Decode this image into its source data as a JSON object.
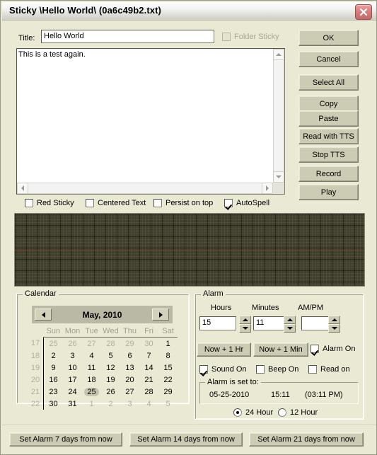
{
  "window": {
    "title": "Sticky \\Hello World\\ (0a6c49b2.txt)",
    "close_label": "close-window"
  },
  "colors": {
    "face": "#e9e9d4",
    "button": "#ccccb4",
    "wave_bg": "#3f3f2c",
    "wave_mid": "#6b3b22",
    "close_red": "#d97f7f"
  },
  "form": {
    "title_label": "Title:",
    "title_value": "Hello World",
    "title_placeholder": "",
    "folder_sticky_label": "Folder Sticky",
    "folder_sticky_checked": false,
    "note_text": "This is a test again.",
    "note_placeholder": ""
  },
  "options": [
    {
      "label": "Red Sticky",
      "checked": false
    },
    {
      "label": "Centered Text",
      "checked": false
    },
    {
      "label": "Persist on top",
      "checked": false
    },
    {
      "label": "AutoSpell",
      "checked": true
    }
  ],
  "buttons": [
    {
      "label": "OK",
      "accel": "O"
    },
    {
      "label": "Cancel",
      "accel": ""
    },
    {
      "label": "Select All",
      "accel": ""
    },
    {
      "label": "Copy",
      "accel": "C"
    },
    {
      "label": "Paste",
      "accel": "P"
    },
    {
      "label": "Read with TTS",
      "accel": "e"
    },
    {
      "label": "Stop TTS",
      "accel": ""
    },
    {
      "label": "Record",
      "accel": "R"
    },
    {
      "label": "Play",
      "accel": "y"
    }
  ],
  "calendar": {
    "group_title": "Calendar",
    "month_label": "May, 2010",
    "prev_label": "previous-month",
    "next_label": "next-month",
    "weekday_headers": [
      "Sun",
      "Mon",
      "Tue",
      "Wed",
      "Thu",
      "Fri",
      "Sat"
    ],
    "week_numbers": [
      17,
      18,
      19,
      20,
      21,
      22
    ],
    "weeks": [
      [
        {
          "d": "25",
          "out": true
        },
        {
          "d": "26",
          "out": true
        },
        {
          "d": "27",
          "out": true
        },
        {
          "d": "28",
          "out": true
        },
        {
          "d": "29",
          "out": true
        },
        {
          "d": "30",
          "out": true
        },
        {
          "d": "1",
          "out": false
        }
      ],
      [
        {
          "d": "2",
          "out": false
        },
        {
          "d": "3",
          "out": false
        },
        {
          "d": "4",
          "out": false
        },
        {
          "d": "5",
          "out": false
        },
        {
          "d": "6",
          "out": false
        },
        {
          "d": "7",
          "out": false
        },
        {
          "d": "8",
          "out": false
        }
      ],
      [
        {
          "d": "9",
          "out": false
        },
        {
          "d": "10",
          "out": false
        },
        {
          "d": "11",
          "out": false
        },
        {
          "d": "12",
          "out": false
        },
        {
          "d": "13",
          "out": false
        },
        {
          "d": "14",
          "out": false
        },
        {
          "d": "15",
          "out": false
        }
      ],
      [
        {
          "d": "16",
          "out": false
        },
        {
          "d": "17",
          "out": false
        },
        {
          "d": "18",
          "out": false
        },
        {
          "d": "19",
          "out": false
        },
        {
          "d": "20",
          "out": false
        },
        {
          "d": "21",
          "out": false
        },
        {
          "d": "22",
          "out": false
        }
      ],
      [
        {
          "d": "23",
          "out": false
        },
        {
          "d": "24",
          "out": false
        },
        {
          "d": "25",
          "out": false,
          "sel": true
        },
        {
          "d": "26",
          "out": false
        },
        {
          "d": "27",
          "out": false
        },
        {
          "d": "28",
          "out": false
        },
        {
          "d": "29",
          "out": false
        }
      ],
      [
        {
          "d": "30",
          "out": false
        },
        {
          "d": "31",
          "out": false
        },
        {
          "d": "1",
          "out": true
        },
        {
          "d": "2",
          "out": true
        },
        {
          "d": "3",
          "out": true
        },
        {
          "d": "4",
          "out": true
        },
        {
          "d": "5",
          "out": true
        }
      ]
    ]
  },
  "alarm": {
    "group_title": "Alarm",
    "hours_label": "Hours",
    "minutes_label": "Minutes",
    "ampm_label": "AM/PM",
    "hours_value": "15",
    "minutes_value": "11",
    "ampm_value": "",
    "now_plus_hr": "Now + 1 Hr",
    "now_plus_min": "Now + 1 Min",
    "alarm_on_label": "Alarm On",
    "alarm_on_checked": true,
    "sound_on_label": "Sound On",
    "sound_on_checked": true,
    "beep_on_label": "Beep On",
    "beep_on_checked": false,
    "read_on_label": "Read on",
    "read_on_checked": false,
    "set_to_title": "Alarm is set to:",
    "set_to_date": "05-25-2010",
    "set_to_time24": "15:11",
    "set_to_time12": "(03:11  PM)",
    "fmt_24_label": "24 Hour",
    "fmt_12_label": "12 Hour",
    "fmt_selected": "24"
  },
  "bottom_buttons": [
    {
      "label": "Set Alarm 7 days from now"
    },
    {
      "label": "Set Alarm 14 days from now"
    },
    {
      "label": "Set Alarm 21 days from now"
    }
  ]
}
